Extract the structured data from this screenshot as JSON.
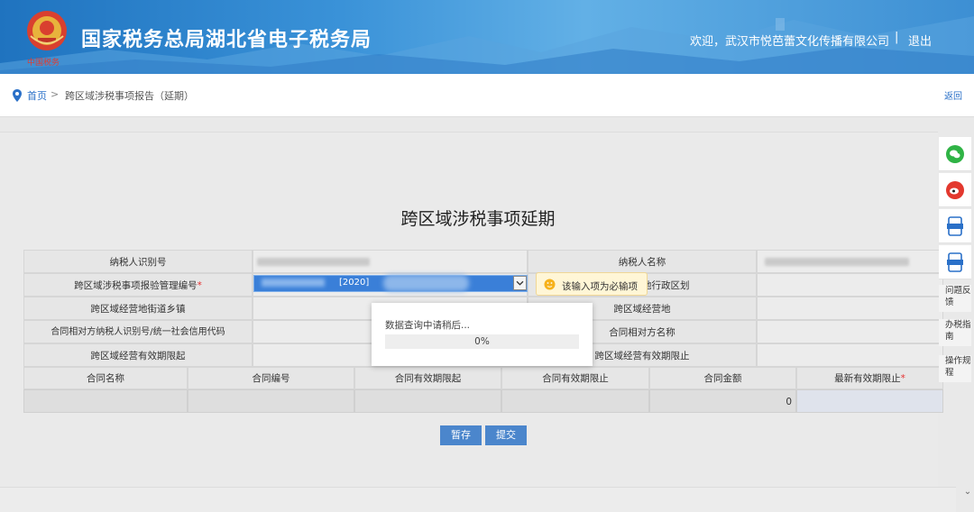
{
  "header": {
    "site_title": "国家税务总局湖北省电子税务局",
    "emblem_subtitle": "中国税务",
    "welcome": "欢迎，武汉市悦芭蕾文化传播有限公司",
    "separator": "|",
    "logout_label": "退出"
  },
  "breadcrumb": {
    "home_label": "首页",
    "separator": ">",
    "current": "跨区域涉税事项报告（延期）",
    "back_label": "返回"
  },
  "form": {
    "title": "跨区域涉税事项延期",
    "labels": {
      "taxpayer_id": "纳税人识别号",
      "taxpayer_name": "纳税人名称",
      "mgmt_no": "跨区域涉税事项报验管理编号",
      "admin_region": "跨区域经营地行政区划",
      "street_town": "跨区域经营地街道乡镇",
      "business_place": "跨区域经营地",
      "counterpart_id": "合同相对方纳税人识别号/统一社会信用代码",
      "counterpart_name": "合同相对方名称",
      "validity_start": "跨区域经营有效期限起",
      "validity_end": "跨区域经营有效期限止"
    },
    "required_mark": "*",
    "mgmt_no_visible": "[2020]",
    "contract_headers": [
      "合同名称",
      "合同编号",
      "合同有效期限起",
      "合同有效期限止",
      "合同金额",
      "最新有效期限止"
    ],
    "contract_amount": "0"
  },
  "tooltip": {
    "icon": "warning-face-icon",
    "text": "该输入项为必输项"
  },
  "modal": {
    "message": "数据查询中请稍后...",
    "progress_text": "0%",
    "progress_value": 0
  },
  "buttons": {
    "save_draft": "暂存",
    "submit": "提交"
  },
  "float_bar": {
    "icons": [
      "wechat-icon",
      "weibo-icon",
      "app-icon",
      "app-icon"
    ],
    "items": [
      "问题反馈",
      "办税指南",
      "操作规程"
    ]
  },
  "colors": {
    "brand_blue": "#2a7dd0",
    "link_blue": "#2a70c8",
    "button_blue": "#4b86cc",
    "required_red": "#e63030",
    "tooltip_bg": "#fff6d6"
  }
}
